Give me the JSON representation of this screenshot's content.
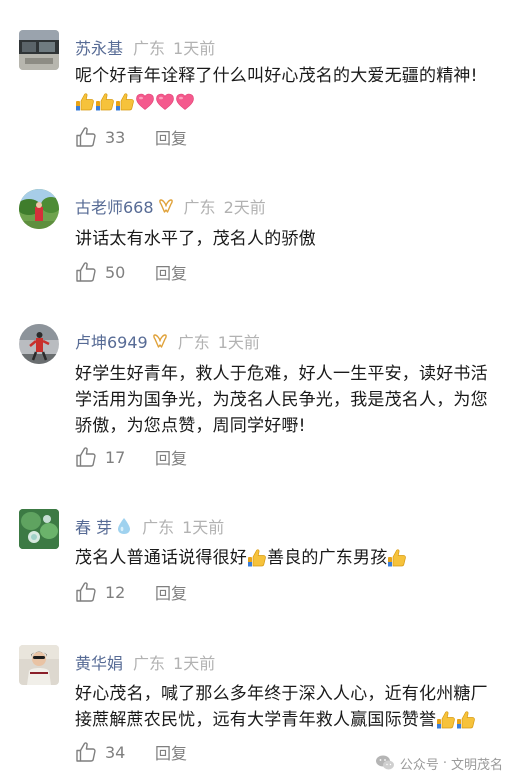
{
  "comments": [
    {
      "author": "苏永基",
      "region": "广东",
      "time": "1天前",
      "text": "呢个好青年诠释了什么叫好心茂名的大爱无疆的精神!",
      "emojis": [
        "thumbs-up-icon",
        "thumbs-up-icon",
        "thumbs-up-icon",
        "heart-icon",
        "heart-icon",
        "heart-icon"
      ],
      "likes": "33",
      "reply_label": "回复"
    },
    {
      "author": "古老师668",
      "badge": "ribbon-icon",
      "region": "广东",
      "time": "2天前",
      "text": "讲话太有水平了，茂名人的骄傲",
      "likes": "50",
      "reply_label": "回复"
    },
    {
      "author": "卢坤6949",
      "badge": "ribbon-icon",
      "region": "广东",
      "time": "1天前",
      "text_lines": [
        "好学生好青年，救人于危难，好人一生平安，读好书活",
        "学活用为国争光，为茂名人民争光，我是茂名人，为您",
        "骄傲，为您点赞，周同学好嘢!"
      ],
      "likes": "17",
      "reply_label": "回复"
    },
    {
      "author": "春 芽",
      "badge": "water-drop-icon",
      "region": "广东",
      "time": "1天前",
      "text_parts": [
        "茂名人普通话说得很好",
        "善良的广东男孩"
      ],
      "likes": "12",
      "reply_label": "回复"
    },
    {
      "author": "黄华娟",
      "region": "广东",
      "time": "1天前",
      "text_lines": [
        "好心茂名，喊了那么多年终于深入人心，近有化州糖厂",
        "接蔗解蔗农民忧，远有大学青年救人赢国际赞誉"
      ],
      "likes": "34",
      "reply_label": "回复"
    }
  ],
  "watermark": {
    "prefix": "公众号",
    "separator": "·",
    "account": "文明茂名"
  },
  "colors": {
    "author": "#576b95",
    "meta_gray": "#b2b2b2",
    "action_gray": "#7f7f7f",
    "text": "#1a1a1a"
  }
}
